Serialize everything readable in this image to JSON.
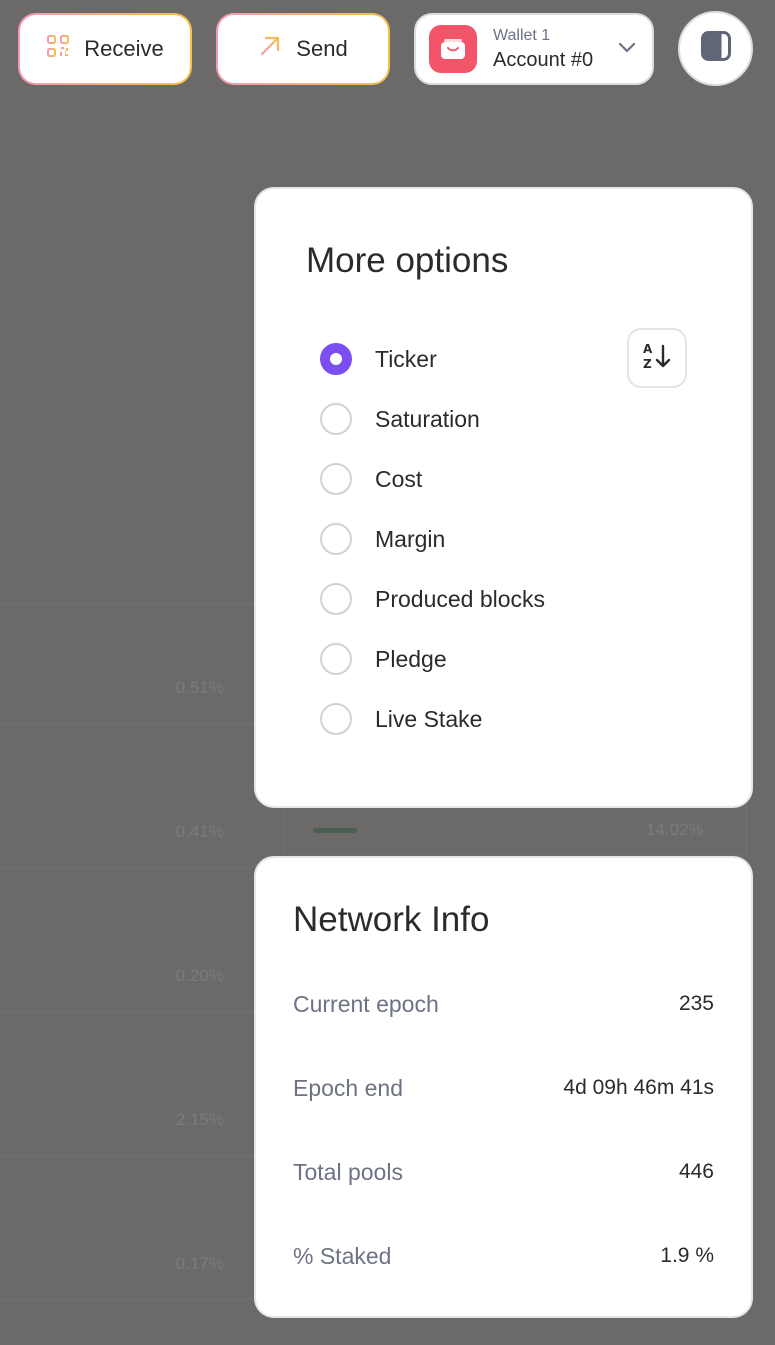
{
  "header": {
    "receive_label": "Receive",
    "send_label": "Send",
    "wallet": {
      "name": "Wallet 1",
      "account": "Account #0"
    }
  },
  "background": {
    "percentages": [
      "0.51%",
      "0.41%",
      "0.20%",
      "2.15%",
      "0.17%"
    ],
    "column_value": "14.02%"
  },
  "more_options": {
    "title": "More options",
    "selected": "Ticker",
    "options": [
      "Ticker",
      "Saturation",
      "Cost",
      "Margin",
      "Produced blocks",
      "Pledge",
      "Live Stake"
    ],
    "sort_icon": "sort-az-descending-icon"
  },
  "network_info": {
    "title": "Network Info",
    "rows": [
      {
        "label": "Current epoch",
        "value": "235"
      },
      {
        "label": "Epoch end",
        "value": "4d 09h 46m 41s"
      },
      {
        "label": "Total pools",
        "value": "446"
      },
      {
        "label": "% Staked",
        "value": "1.9 %"
      }
    ]
  },
  "colors": {
    "overlay": "#6b6a69",
    "accent": "#7c4ef0",
    "wallet_icon": "#f25469",
    "gradient_start": "#f59ab5",
    "gradient_end": "#f6c04a"
  }
}
